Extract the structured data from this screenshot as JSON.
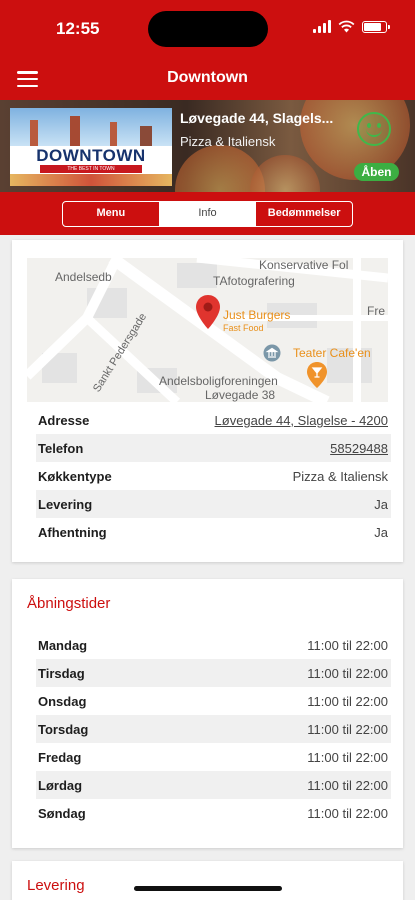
{
  "status": {
    "time": "12:55"
  },
  "header": {
    "title": "Downtown"
  },
  "restaurant": {
    "address": "Løvegade 44, Slagels...",
    "category": "Pizza & Italiensk",
    "open_label": "Åben",
    "logo": {
      "name": "DOWNTOWN",
      "tagline": "THE BEST IN TOWN"
    }
  },
  "tabs": [
    {
      "label": "Menu"
    },
    {
      "label": "Info"
    },
    {
      "label": "Bedømmelser"
    }
  ],
  "active_tab": "Info",
  "map": {
    "streets": [
      "Konservative Fol",
      "Andelsedb",
      "TAfotografering",
      "Sankt Pedersgade",
      "Andelsboligforeningen",
      "Løvegade 38",
      "Fre"
    ],
    "marker_name": "Just Burgers",
    "marker_category": "Fast Food",
    "poi": "Teater Cafe'en"
  },
  "info": [
    {
      "label": "Adresse",
      "value": "Løvegade 44, Slagelse - 4200"
    },
    {
      "label": "Telefon",
      "value": "58529488"
    },
    {
      "label": "Køkkentype",
      "value": "Pizza & Italiensk"
    },
    {
      "label": "Levering",
      "value": "Ja"
    },
    {
      "label": "Afhentning",
      "value": "Ja"
    }
  ],
  "opening_hours": {
    "title": "Åbningstider",
    "days": [
      {
        "day": "Mandag",
        "hours": "11:00 til 22:00"
      },
      {
        "day": "Tirsdag",
        "hours": "11:00 til 22:00"
      },
      {
        "day": "Onsdag",
        "hours": "11:00 til 22:00"
      },
      {
        "day": "Torsdag",
        "hours": "11:00 til 22:00"
      },
      {
        "day": "Fredag",
        "hours": "11:00 til 22:00"
      },
      {
        "day": "Lørdag",
        "hours": "11:00 til 22:00"
      },
      {
        "day": "Søndag",
        "hours": "11:00 til 22:00"
      }
    ]
  },
  "delivery": {
    "title": "Levering"
  },
  "colors": {
    "brand_red": "#cc0f0f",
    "open_green": "#3cae42",
    "poi_orange": "#e9901b"
  },
  "icons": [
    "menu-icon",
    "wifi-icon",
    "signal-icon",
    "battery-icon",
    "smiley-icon",
    "location-pin-icon",
    "cafe-icon",
    "museum-icon"
  ]
}
